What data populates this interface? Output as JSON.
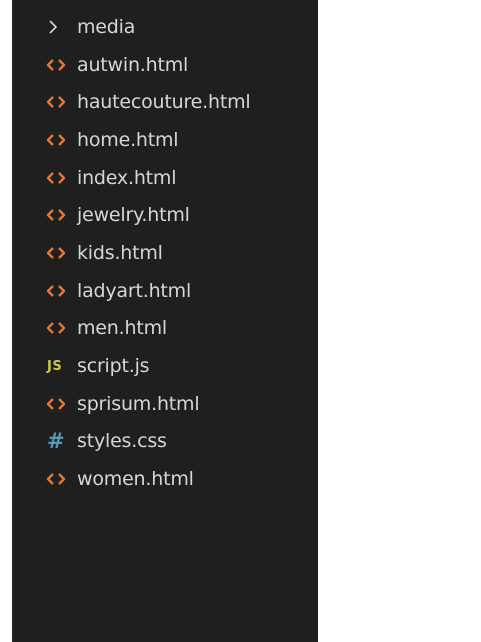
{
  "explorer": {
    "items": [
      {
        "label": "media",
        "kind": "folder",
        "icon": "chevron-right-icon"
      },
      {
        "label": "autwin.html",
        "kind": "html",
        "icon": "html-file-icon"
      },
      {
        "label": "hautecouture.html",
        "kind": "html",
        "icon": "html-file-icon"
      },
      {
        "label": "home.html",
        "kind": "html",
        "icon": "html-file-icon"
      },
      {
        "label": "index.html",
        "kind": "html",
        "icon": "html-file-icon"
      },
      {
        "label": "jewelry.html",
        "kind": "html",
        "icon": "html-file-icon"
      },
      {
        "label": "kids.html",
        "kind": "html",
        "icon": "html-file-icon"
      },
      {
        "label": "ladyart.html",
        "kind": "html",
        "icon": "html-file-icon"
      },
      {
        "label": "men.html",
        "kind": "html",
        "icon": "html-file-icon"
      },
      {
        "label": "script.js",
        "kind": "js",
        "icon": "js-file-icon",
        "icon_text": "JS"
      },
      {
        "label": "sprisum.html",
        "kind": "html",
        "icon": "html-file-icon"
      },
      {
        "label": "styles.css",
        "kind": "css",
        "icon": "css-file-icon",
        "icon_text": "#"
      },
      {
        "label": "women.html",
        "kind": "html",
        "icon": "html-file-icon"
      }
    ]
  },
  "colors": {
    "background": "#1f1f1f",
    "text": "#d6d6d6",
    "html_icon": "#e37933",
    "js_icon": "#cbcb41",
    "css_icon": "#519aba"
  }
}
